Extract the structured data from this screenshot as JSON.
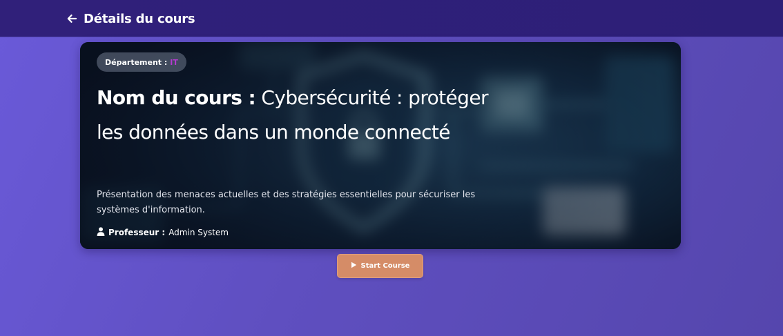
{
  "header": {
    "back_icon": "arrow-left-icon",
    "title": "Détails du cours",
    "background": "#2e2079"
  },
  "course": {
    "department_label": "Département :",
    "department_value": "IT",
    "title_label": "Nom du cours :",
    "title": "Cybersécurité : protéger les données dans un monde connecté",
    "description": "Présentation des menaces actuelles et des stratégies essentielles pour sécuriser les systèmes d'information.",
    "professor_icon": "user-icon",
    "professor_label": "Professeur :",
    "professor_name": "Admin System",
    "image_icon": "shield-circuit-background"
  },
  "actions": {
    "start_icon": "play-icon",
    "start_label": "Start Course",
    "start_color": "#d58c67"
  },
  "colors": {
    "page_background": "#5f4fc0",
    "department_accent": "#b53bd0"
  }
}
